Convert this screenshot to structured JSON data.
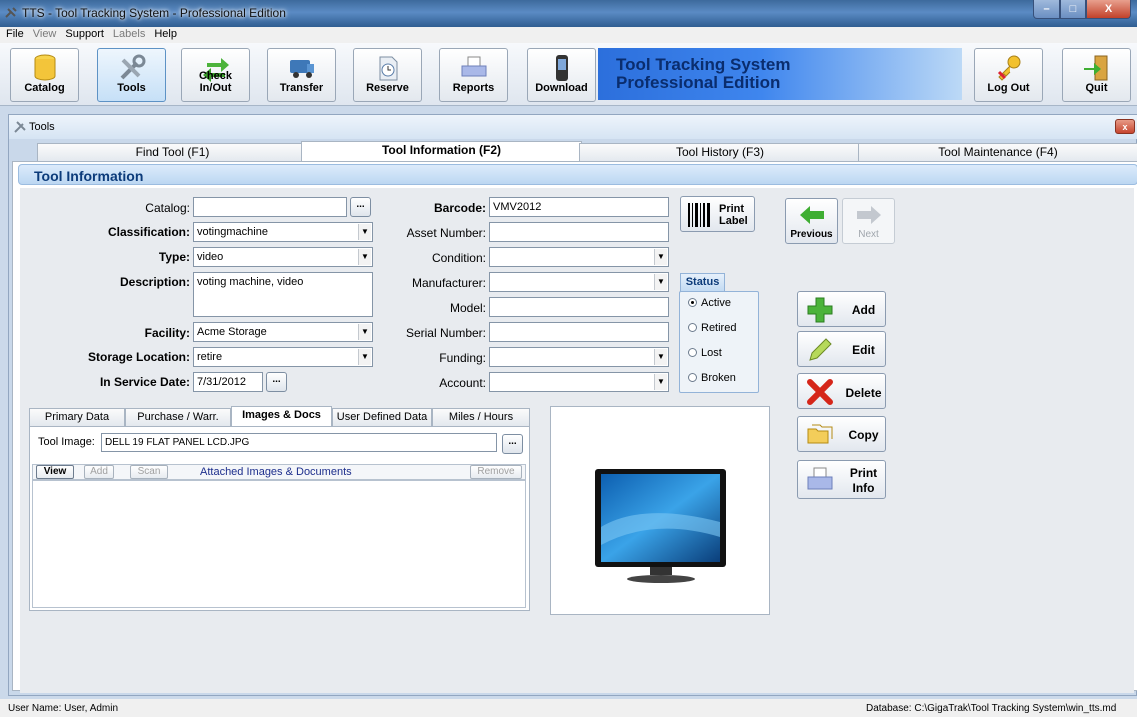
{
  "window": {
    "title": "TTS - Tool Tracking System - Professional Edition"
  },
  "menu": [
    {
      "label": "File",
      "enabled": true
    },
    {
      "label": "View",
      "enabled": false
    },
    {
      "label": "Support",
      "enabled": true
    },
    {
      "label": "Labels",
      "enabled": false
    },
    {
      "label": "Help",
      "enabled": true
    }
  ],
  "toolbar": {
    "catalog": "Catalog",
    "tools": "Tools",
    "checkinout": "Check In/Out",
    "transfer": "Transfer",
    "reserve": "Reserve",
    "reports": "Reports",
    "download": "Download",
    "logout": "Log Out",
    "quit": "Quit",
    "banner_line1": "Tool Tracking System",
    "banner_line2": "Professional Edition"
  },
  "toolswin": {
    "title": "Tools",
    "close": "x",
    "tabs": [
      "Find Tool (F1)",
      "Tool Information (F2)",
      "Tool History (F3)",
      "Tool Maintenance (F4)"
    ],
    "section_title": "Tool Information"
  },
  "form": {
    "catalog_label": "Catalog:",
    "catalog_value": "",
    "classification_label": "Classification:",
    "classification_value": "votingmachine",
    "type_label": "Type:",
    "type_value": "video",
    "description_label": "Description:",
    "description_value": "voting machine, video",
    "facility_label": "Facility:",
    "facility_value": "Acme Storage",
    "storage_label": "Storage Location:",
    "storage_value": "retire",
    "inservice_label": "In Service Date:",
    "inservice_value": "7/31/2012",
    "barcode_label": "Barcode:",
    "barcode_value": "VMV2012",
    "asset_label": "Asset Number:",
    "asset_value": "",
    "condition_label": "Condition:",
    "condition_value": "",
    "manufacturer_label": "Manufacturer:",
    "manufacturer_value": "",
    "model_label": "Model:",
    "model_value": "",
    "serial_label": "Serial Number:",
    "serial_value": "",
    "funding_label": "Funding:",
    "funding_value": "",
    "account_label": "Account:",
    "account_value": "",
    "ellipsis": "...",
    "print_label_line1": "Print",
    "print_label_line2": "Label"
  },
  "status": {
    "title": "Status",
    "options": [
      "Active",
      "Retired",
      "Lost",
      "Broken"
    ],
    "selected": "Active"
  },
  "nav": {
    "previous": "Previous",
    "next": "Next"
  },
  "actions": {
    "add": "Add",
    "edit": "Edit",
    "delete": "Delete",
    "copy": "Copy",
    "print_line1": "Print",
    "print_line2": "Info"
  },
  "subtabs": [
    "Primary Data",
    "Purchase / Warr.",
    "Images & Docs",
    "User Defined Data",
    "Miles / Hours"
  ],
  "images": {
    "tool_image_label": "Tool Image:",
    "tool_image_value": "DELL 19 FLAT PANEL LCD.JPG",
    "view": "View",
    "add": "Add",
    "scan": "Scan",
    "list_title": "Attached Images & Documents",
    "remove": "Remove"
  },
  "statusbar": {
    "user": "User Name:  User, Admin",
    "database": "Database:  C:\\GigaTrak\\Tool Tracking System\\win_tts.md"
  },
  "colors": {
    "accent": "#0c3b7a",
    "banner": "#3f86ee"
  }
}
